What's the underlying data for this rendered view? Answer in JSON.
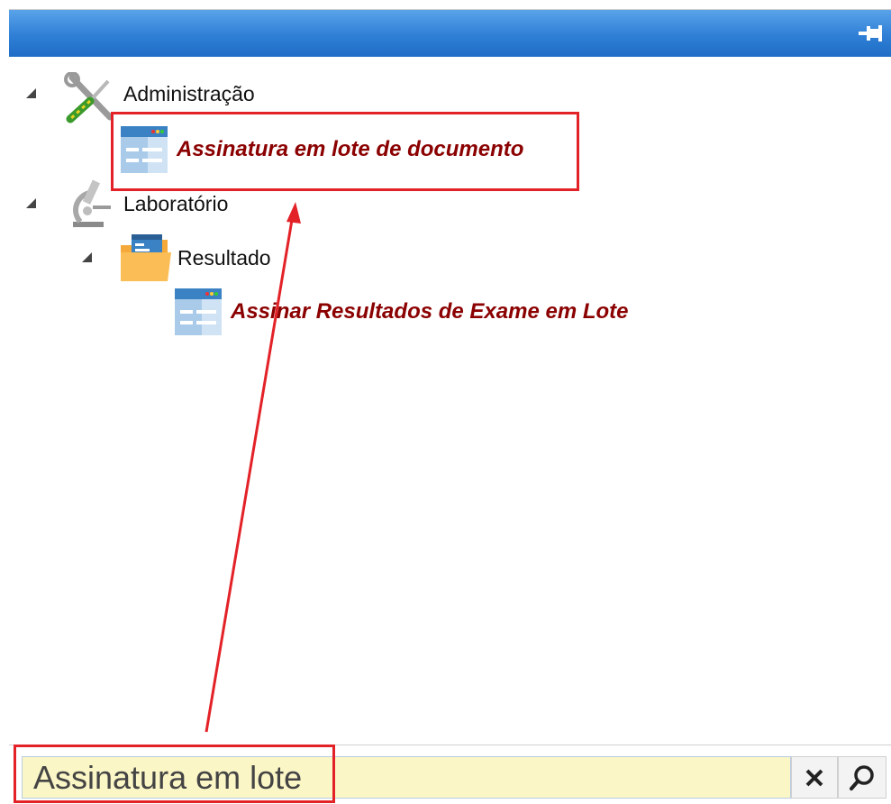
{
  "header": {
    "pin_icon": "pin-icon"
  },
  "tree": {
    "administracao": {
      "label": "Administração",
      "icon": "tools-icon"
    },
    "assinatura_lote": {
      "label": "Assinatura em lote de documento",
      "icon": "window-form-icon"
    },
    "laboratorio": {
      "label": "Laboratório",
      "icon": "microscope-icon"
    },
    "resultado": {
      "label": "Resultado",
      "icon": "folder-icon"
    },
    "assinar_resultados": {
      "label": "Assinar Resultados de Exame em Lote",
      "icon": "window-form-icon"
    }
  },
  "search": {
    "value": "Assinatura em lote",
    "clear_icon": "close-icon",
    "search_icon": "search-icon"
  },
  "colors": {
    "header": "#2f7fd6",
    "leaf_text": "#8b0000",
    "annotation": "#e32228",
    "search_bg": "#fbf6c6"
  }
}
